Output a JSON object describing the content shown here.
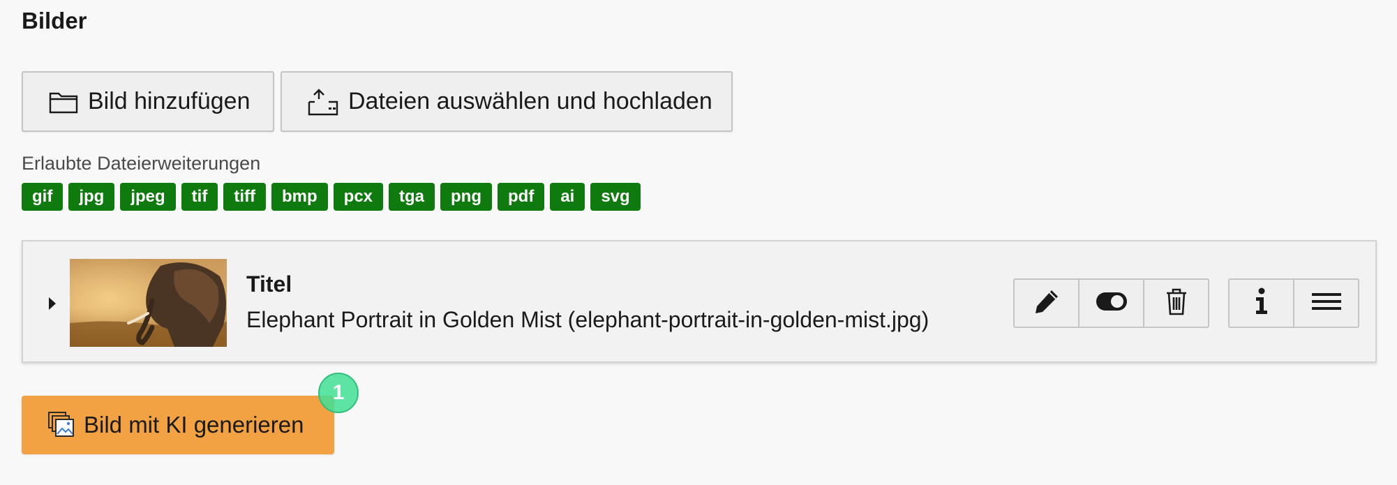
{
  "section": {
    "title": "Bilder"
  },
  "toolbar": {
    "add_image_label": "Bild hinzufügen",
    "upload_label": "Dateien auswählen und hochladen"
  },
  "extensions": {
    "label": "Erlaubte Dateierweiterungen",
    "items": [
      "gif",
      "jpg",
      "jpeg",
      "tif",
      "tiff",
      "bmp",
      "pcx",
      "tga",
      "png",
      "pdf",
      "ai",
      "svg"
    ],
    "badge_color": "#0f7b0f"
  },
  "file": {
    "title": "Titel",
    "name": "Elephant Portrait in Golden Mist (elephant-portrait-in-golden-mist.jpg)",
    "thumbnail_icon": "elephant-thumbnail",
    "actions": [
      {
        "name": "edit",
        "icon": "pencil-icon"
      },
      {
        "name": "toggle-visibility",
        "icon": "toggle-icon"
      },
      {
        "name": "delete",
        "icon": "trash-icon"
      },
      {
        "name": "info",
        "icon": "info-icon"
      },
      {
        "name": "sort",
        "icon": "hamburger-icon"
      }
    ]
  },
  "ai": {
    "generate_label": "Bild mit KI generieren",
    "button_color": "#f2a143"
  },
  "marker": {
    "label": "1",
    "color": "#42e096"
  }
}
